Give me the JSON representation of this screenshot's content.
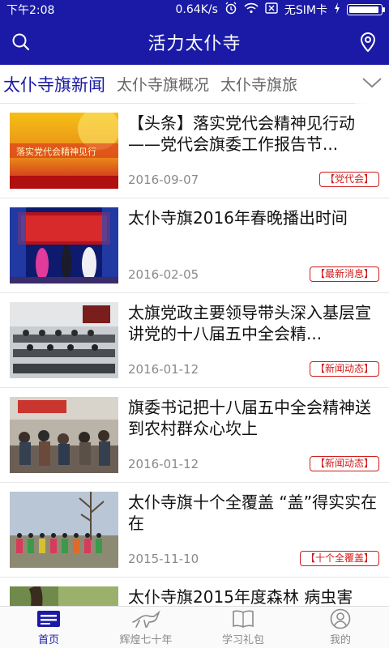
{
  "status_bar": {
    "time": "下午2:08",
    "speed": "0.64K/s",
    "sim": "无SIM卡",
    "battery_level": 0.95
  },
  "header": {
    "title": "活力太仆寺"
  },
  "tabs": [
    {
      "label": "太仆寺旗新闻",
      "active": true
    },
    {
      "label": "太仆寺旗概况",
      "active": false
    },
    {
      "label": "太仆寺旗旅",
      "active": false
    }
  ],
  "news": [
    {
      "title": "【头条】落实党代会精神见行动——党代会旗委工作报告节...",
      "date": "2016-09-07",
      "tag": "【党代会】"
    },
    {
      "title": "太仆寺旗2016年春晚播出时间",
      "date": "2016-02-05",
      "tag": "【最新消息】"
    },
    {
      "title": "太旗党政主要领导带头深入基层宣讲党的十八届五中全会精...",
      "date": "2016-01-12",
      "tag": "【新闻动态】"
    },
    {
      "title": "旗委书记把十八届五中全会精神送到农村群众心坎上",
      "date": "2016-01-12",
      "tag": "【新闻动态】"
    },
    {
      "title": "太仆寺旗十个全覆盖 “盖”得实实在在",
      "date": "2015-11-10",
      "tag": "【十个全覆盖】"
    },
    {
      "title": "太仆寺旗2015年度森林 病虫害",
      "date": "",
      "tag": ""
    }
  ],
  "bottom_nav": [
    {
      "label": "首页",
      "icon": "home-news-icon",
      "active": true
    },
    {
      "label": "辉煌七十年",
      "icon": "horse-icon",
      "active": false
    },
    {
      "label": "学习礼包",
      "icon": "book-icon",
      "active": false
    },
    {
      "label": "我的",
      "icon": "user-icon",
      "active": false
    }
  ],
  "colors": {
    "primary": "#1a1aa6",
    "tag_red": "#d21a1a"
  }
}
